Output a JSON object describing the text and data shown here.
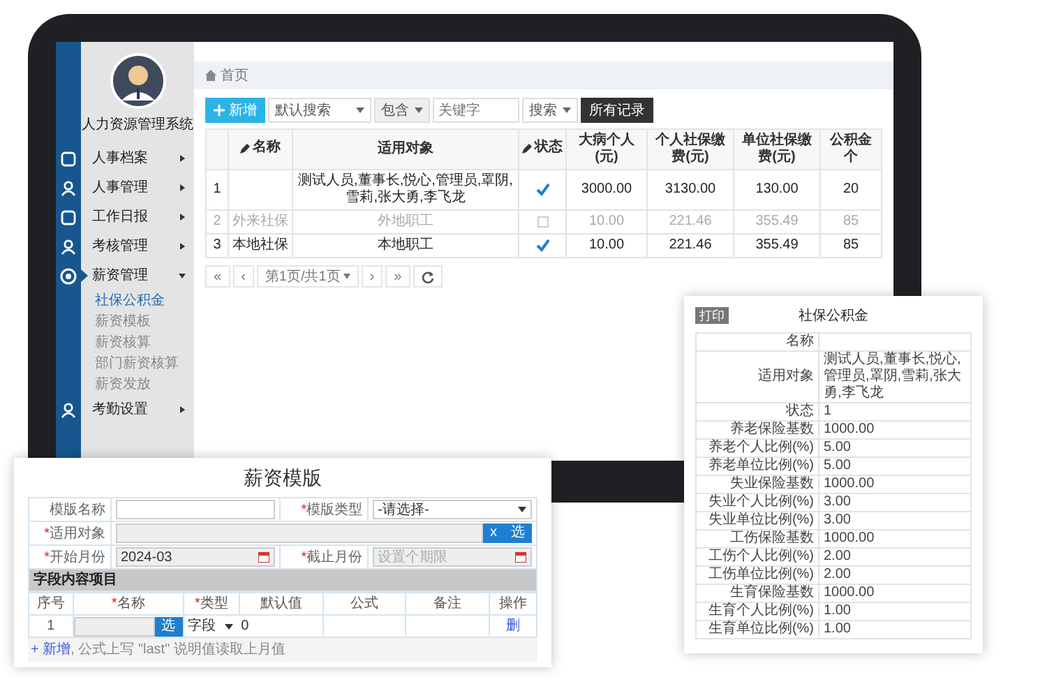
{
  "sidebar": {
    "app_title": "人力资源管理系统",
    "menu": [
      {
        "label": "人事档案",
        "expanded": false
      },
      {
        "label": "人事管理",
        "expanded": false
      },
      {
        "label": "工作日报",
        "expanded": false
      },
      {
        "label": "考核管理",
        "expanded": false
      },
      {
        "label": "薪资管理",
        "expanded": true,
        "children": [
          {
            "label": "社保公积金",
            "selected": true
          },
          {
            "label": "薪资模板",
            "selected": false
          },
          {
            "label": "薪资核算",
            "selected": false
          },
          {
            "label": "部门薪资核算",
            "selected": false
          },
          {
            "label": "薪资发放",
            "selected": false
          }
        ]
      },
      {
        "label": "考勤设置",
        "expanded": false
      }
    ]
  },
  "breadcrumb": "首页",
  "toolbar": {
    "add_button": "新增",
    "search_mode": "默认搜索",
    "match_mode": "包含",
    "keyword_placeholder": "关键字",
    "search_button": "搜索",
    "all_records_button": "所有记录"
  },
  "main_table": {
    "columns": [
      {
        "editable": false
      },
      {
        "label": "名称",
        "editable": true
      },
      {
        "label": "适用对象",
        "editable": false
      },
      {
        "label": "状态",
        "editable": true
      },
      {
        "label": "大病个人(元)",
        "editable": false
      },
      {
        "label": "个人社保缴费(元)",
        "editable": false
      },
      {
        "label": "单位社保缴费(元)",
        "editable": false
      },
      {
        "label": "公积金个",
        "editable": false
      }
    ],
    "rows": [
      {
        "index": "1",
        "name": "",
        "target": "测试人员,董事长,悦心,管理员,罩阴,雪莉,张大勇,李飞龙",
        "checked": true,
        "disabled": false,
        "illness": "3000.00",
        "personal": "3130.00",
        "company": "130.00",
        "fund": "20"
      },
      {
        "index": "2",
        "name": "外来社保",
        "target": "外地职工",
        "checked": false,
        "disabled": true,
        "illness": "10.00",
        "personal": "221.46",
        "company": "355.49",
        "fund": "85"
      },
      {
        "index": "3",
        "name": "本地社保",
        "target": "本地职工",
        "checked": true,
        "disabled": false,
        "illness": "10.00",
        "personal": "221.46",
        "company": "355.49",
        "fund": "85"
      }
    ]
  },
  "pagination": {
    "buttons": [
      "«",
      "‹",
      "第1页/共1页",
      "›",
      "»"
    ]
  },
  "detail_card": {
    "print_button": "打印",
    "title": "社保公积金",
    "rows": [
      {
        "label": "名称"
      },
      {
        "label": "适用对象",
        "value": "测试人员,董事长,悦心,管理员,罩阴,雪莉,张大勇,李飞龙"
      },
      {
        "label": "状态",
        "value": "1"
      },
      {
        "label": "养老保险基数",
        "value": "1000.00"
      },
      {
        "label": "养老个人比例(%)",
        "value": "5.00"
      },
      {
        "label": "养老单位比例(%)",
        "value": "5.00"
      },
      {
        "label": "失业保险基数",
        "value": "1000.00"
      },
      {
        "label": "失业个人比例(%)",
        "value": "3.00"
      },
      {
        "label": "失业单位比例(%)",
        "value": "3.00"
      },
      {
        "label": "工伤保险基数",
        "value": "1000.00"
      },
      {
        "label": "工伤个人比例(%)",
        "value": "2.00"
      },
      {
        "label": "工伤单位比例(%)",
        "value": "2.00"
      },
      {
        "label": "生育保险基数",
        "value": "1000.00"
      },
      {
        "label": "生育个人比例(%)",
        "value": "1.00"
      },
      {
        "label": "生育单位比例(%)",
        "value": "1.00"
      }
    ]
  },
  "template_form": {
    "title": "薪资模版",
    "rows": [
      {
        "fields": [
          {
            "label": "模版名称",
            "required": false,
            "kind": "text"
          },
          {
            "label": "*模版类型",
            "required": true,
            "kind": "select",
            "value": "-请选择-"
          }
        ]
      },
      {
        "fields": [
          {
            "label": "*适用对象",
            "required": true,
            "kind": "picker",
            "buttons": [
              "x",
              "选"
            ]
          }
        ]
      },
      {
        "fields": [
          {
            "label": "*开始月份",
            "required": true,
            "kind": "date",
            "value": "2024-03"
          },
          {
            "label": "*截止月份",
            "required": true,
            "kind": "date",
            "placeholder": "设置个期限"
          }
        ]
      }
    ],
    "section_title": "字段内容项目",
    "item_columns": [
      {
        "label": "序号",
        "required": false
      },
      {
        "label": "*名称",
        "required": true
      },
      {
        "label": "*类型",
        "required": true
      },
      {
        "label": "默认值",
        "required": false
      },
      {
        "label": "公式",
        "required": false
      },
      {
        "label": "备注",
        "required": false
      },
      {
        "label": "操作",
        "required": false
      }
    ],
    "item_rows": [
      {
        "index": "1",
        "pick_button": "选",
        "type": "字段",
        "default": "0",
        "delete_link": "删"
      }
    ],
    "add_link": "+ 新增",
    "note": ", 公式上写 \"last\" 说明值读取上月值"
  }
}
